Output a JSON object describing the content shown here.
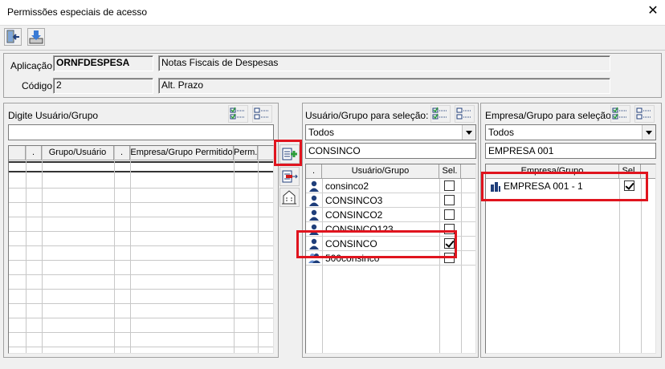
{
  "window": {
    "title": "Permissões especiais de acesso",
    "close": "✕"
  },
  "form": {
    "aplicacao_label": "Aplicação",
    "aplicacao_code": "ORNFDESPESA",
    "aplicacao_desc": "Notas Fiscais de Despesas",
    "codigo_label": "Código",
    "codigo_value": "2",
    "codigo_desc": "Alt. Prazo"
  },
  "left_panel": {
    "label": "Digite Usuário/Grupo",
    "input_value": "",
    "columns": [
      ".",
      "Grupo/Usuário",
      ".",
      "Empresa/Grupo Permitido",
      "Perm."
    ]
  },
  "middle_panel": {
    "label": "Usuário/Grupo para seleção:",
    "filter_selected": "Todos",
    "search_value": "CONSINCO",
    "columns": [
      ".",
      "Usuário/Grupo",
      "Sel."
    ],
    "rows": [
      {
        "name": "consinco2",
        "selected": false,
        "icon": "user-icon"
      },
      {
        "name": "CONSINCO3",
        "selected": false,
        "icon": "user-icon"
      },
      {
        "name": "CONSINCO2",
        "selected": false,
        "icon": "user-icon"
      },
      {
        "name": "CONSINCO123",
        "selected": false,
        "icon": "user-icon"
      },
      {
        "name": "CONSINCO",
        "selected": true,
        "icon": "user-icon"
      },
      {
        "name": "500consinco",
        "selected": false,
        "icon": "group-icon"
      }
    ]
  },
  "right_panel": {
    "label": "Empresa/Grupo para seleção:",
    "filter_selected": "Todos",
    "search_value": "EMPRESA 001",
    "columns": [
      "Empresa/Grupo",
      "Sel."
    ],
    "rows": [
      {
        "name": "EMPRESA 001 - 1",
        "selected": true,
        "icon": "building-icon"
      }
    ]
  },
  "colors": {
    "highlight": "#e0141e",
    "icon_blue": "#1f3e7a",
    "icon_green": "#2d9d3a"
  }
}
